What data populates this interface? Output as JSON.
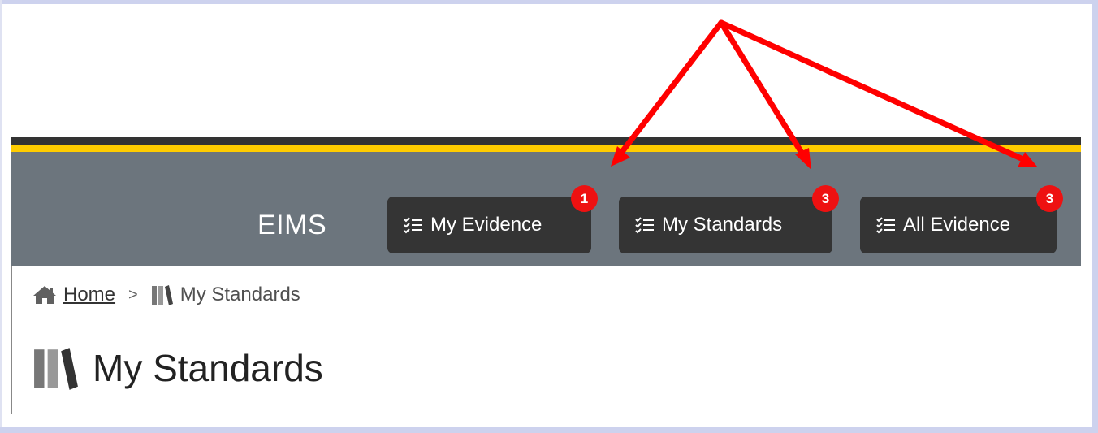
{
  "header": {
    "brand": "EIMS",
    "nav_buttons": [
      {
        "label": "My Evidence",
        "badge": "1"
      },
      {
        "label": "My Standards",
        "badge": "3"
      },
      {
        "label": "All Evidence",
        "badge": "3"
      }
    ]
  },
  "breadcrumb": {
    "home_label": "Home",
    "separator": ">",
    "current_label": "My Standards"
  },
  "page": {
    "title": "My Standards"
  },
  "icons": {
    "home": "home-icon",
    "nav": "checklist-icon",
    "books": "books-icon"
  },
  "colors": {
    "nav_bg": "#6c757d",
    "accent_yellow": "#ffcc00",
    "button_bg": "#343434",
    "badge_red": "#ee1111",
    "annotation_red": "#ff0000"
  }
}
